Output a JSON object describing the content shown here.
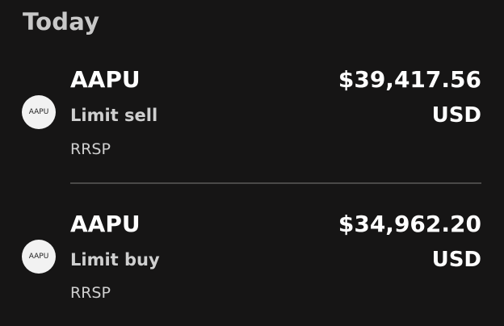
{
  "section": {
    "title": "Today"
  },
  "orders": [
    {
      "avatar_text": "AAPU",
      "ticker": "AAPU",
      "order_type": "Limit sell",
      "account": "RRSP",
      "amount": "$39,417.56",
      "currency": "USD"
    },
    {
      "avatar_text": "AAPU",
      "ticker": "AAPU",
      "order_type": "Limit buy",
      "account": "RRSP",
      "amount": "$34,962.20",
      "currency": "USD"
    }
  ]
}
